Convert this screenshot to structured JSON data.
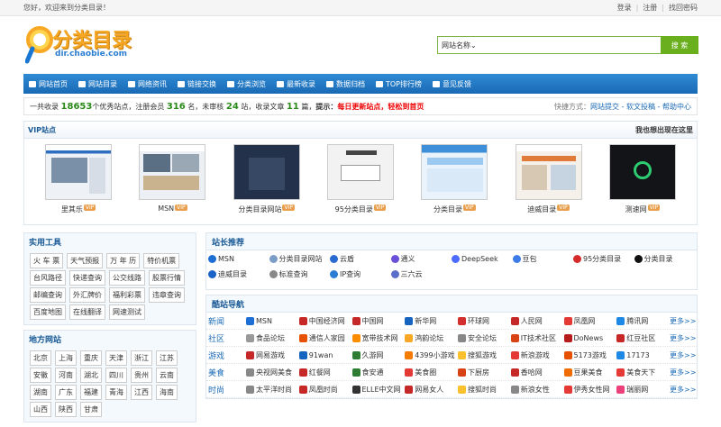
{
  "topbar": {
    "welcome": "您好，欢迎来到分类目录！",
    "login": "登录",
    "register": "注册",
    "forgot": "找回密码"
  },
  "logo": {
    "title": "分类目录",
    "domain": "dir.chaobie.com"
  },
  "search": {
    "scope": "网站名称",
    "button": "搜 索"
  },
  "nav": [
    "网站首页",
    "网站目录",
    "网络资讯",
    "链接交换",
    "分类浏览",
    "最新收录",
    "数据归档",
    "TOP排行榜",
    "意见反馈"
  ],
  "stats": {
    "t1": "一共收录",
    "sites": "18653",
    "t2": "个优秀站点，注册会员",
    "members": "316",
    "t3": "名，未审核",
    "pending": "24",
    "t4": "站，收录文章",
    "articles": "11",
    "t5": "篇，",
    "tip_label": "提示：",
    "tip": "每日更新站点，轻松到首页",
    "quick": "快捷方式：",
    "q1": "网站提交",
    "q2": "软文投稿",
    "q3": "帮助中心"
  },
  "vip": {
    "title": "VIP站点",
    "cta": "我也想出现在这里",
    "tag": "VIP",
    "items": [
      "里其乐",
      "MSN",
      "分类目录网站",
      "95分类目录",
      "分类目录",
      "迪威目录",
      "测速网"
    ]
  },
  "tools": {
    "title": "实用工具",
    "items": [
      "火 车 票",
      "天气预报",
      "万 年 历",
      "特价机票",
      "台风路径",
      "快递查询",
      "公交线路",
      "股票行情",
      "邮编查询",
      "外汇牌价",
      "福利彩票",
      "违章查询",
      "百度地图",
      "在线翻译",
      "网速测试"
    ]
  },
  "regions": {
    "title": "地方网站",
    "items": [
      "北京",
      "上海",
      "重庆",
      "天津",
      "浙江",
      "江苏",
      "安徽",
      "河南",
      "湖北",
      "四川",
      "贵州",
      "云南",
      "湖南",
      "广东",
      "福建",
      "青海",
      "江西",
      "海南",
      "山西",
      "陕西",
      "甘肃"
    ]
  },
  "rec": {
    "title": "站长推荐",
    "items": [
      {
        "name": "MSN",
        "color": "#1d6fd6"
      },
      {
        "name": "分类目录网站",
        "color": "#7a9cc6"
      },
      {
        "name": "云盾",
        "color": "#2a6bd1"
      },
      {
        "name": "通义",
        "color": "#6a4fd8"
      },
      {
        "name": "DeepSeek",
        "color": "#4d6bfe"
      },
      {
        "name": "豆包",
        "color": "#3c7be8"
      },
      {
        "name": "95分类目录",
        "color": "#d42a2a"
      },
      {
        "name": "分类目录",
        "color": "#111111"
      },
      {
        "name": "迪威目录",
        "color": "#1b63c6"
      },
      {
        "name": "标准查询",
        "color": "#888888"
      },
      {
        "name": "IP查询",
        "color": "#2b7cd4"
      },
      {
        "name": "三六云",
        "color": "#5a6fc9"
      }
    ]
  },
  "cool": {
    "title": "酷站导航",
    "more": "更多>>",
    "rows": [
      {
        "cat": "新闻",
        "sites": [
          "MSN",
          "中国经济网",
          "中国网",
          "新华网",
          "环球网",
          "人民网",
          "凤凰网",
          "腾讯网"
        ],
        "colors": [
          "#1d6fd6",
          "#c62828",
          "#c62828",
          "#1565c0",
          "#d32f2f",
          "#c62828",
          "#e53935",
          "#1e88e5"
        ]
      },
      {
        "cat": "社区",
        "sites": [
          "食品论坛",
          "通信人家园",
          "宽带技术网",
          "鸿韵论坛",
          "安全论坛",
          "IT技术社区",
          "DoNews",
          "红豆社区"
        ],
        "colors": [
          "#999999",
          "#e65100",
          "#fb8c00",
          "#f9a825",
          "#888888",
          "#d84315",
          "#b71c1c",
          "#c62828"
        ]
      },
      {
        "cat": "游戏",
        "sites": [
          "网易游戏",
          "91wan",
          "久游网",
          "4399小游戏",
          "搜狐游戏",
          "新浪游戏",
          "5173游戏",
          "17173"
        ],
        "colors": [
          "#c62828",
          "#1565c0",
          "#2e7d32",
          "#f57c00",
          "#fbc02d",
          "#e53935",
          "#e65100",
          "#1e88e5"
        ]
      },
      {
        "cat": "美食",
        "sites": [
          "央视网美食",
          "红餐网",
          "食安通",
          "美食圈",
          "下厨房",
          "香哈网",
          "豆果美食",
          "美食天下"
        ],
        "colors": [
          "#888888",
          "#c62828",
          "#2e7d32",
          "#e53935",
          "#d84315",
          "#c62828",
          "#ef6c00",
          "#e53935"
        ]
      },
      {
        "cat": "时尚",
        "sites": [
          "太平洋时尚",
          "凤凰时尚",
          "ELLE中文网",
          "网易女人",
          "搜狐时尚",
          "新浪女性",
          "伊秀女性网",
          "瑞丽网"
        ],
        "colors": [
          "#888888",
          "#c62828",
          "#333333",
          "#c62828",
          "#fbc02d",
          "#888888",
          "#e53935",
          "#ec407a"
        ]
      }
    ]
  }
}
